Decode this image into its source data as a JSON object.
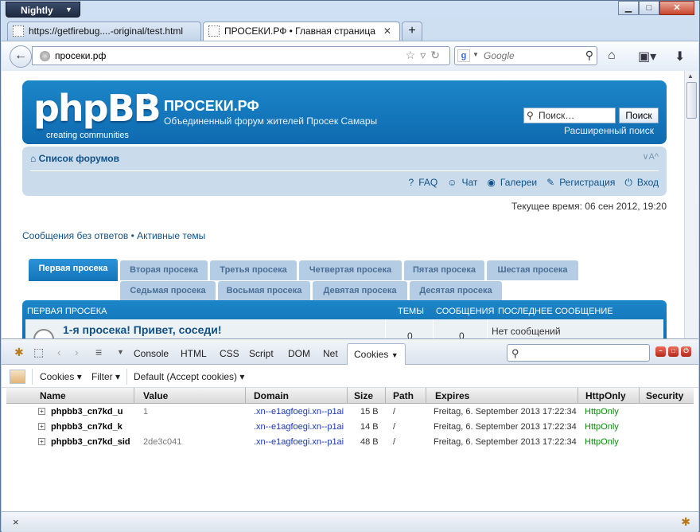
{
  "browser": {
    "app_menu": "Nightly",
    "window_buttons": {
      "minimize": "▁",
      "maximize": "□",
      "close": "✕"
    },
    "tabs": [
      {
        "label": "https://getfirebug....-original/test.html"
      },
      {
        "label": "ПРОСЕКИ.РФ • Главная страница"
      }
    ],
    "new_tab": "+",
    "url": "просеки.рф",
    "search_placeholder": "Google",
    "search_engine_icon": "g"
  },
  "site": {
    "logo": "phpBB",
    "logo_reg": "®",
    "logo_tagline": "creating  communities",
    "title": "ПРОСЕКИ.РФ",
    "description": "Объединенный форум жителей Просек Самары",
    "search_value": "Поиск…",
    "search_button": "Поиск",
    "advanced_search": "Расширенный поиск",
    "forum_list": "Список форумов",
    "font_size": "∨A^",
    "nav_links": [
      "FAQ",
      "Чат",
      "Галереи",
      "Регистрация",
      "Вход"
    ],
    "nav_icons": [
      "?",
      "☺",
      "◉",
      "✎",
      "⏻"
    ],
    "current_time": "Текущее время: 06 сен 2012, 19:20",
    "quick_links": "Сообщения без ответов • Активные темы",
    "forum_tabs_row1": [
      "Первая просека",
      "Вторая просека",
      "Третья просека",
      "Четвертая просека",
      "Пятая просека",
      "Шестая просека"
    ],
    "forum_tabs_row2": [
      "Седьмая просека",
      "Восьмая просека",
      "Девятая просека",
      "Десятая просека"
    ],
    "table_headers": {
      "forum": "ПЕРВАЯ ПРОСЕКА",
      "topics": "ТЕМЫ",
      "posts": "СООБЩЕНИЯ",
      "last": "ПОСЛЕДНЕЕ СООБЩЕНИЕ"
    },
    "forum_row": {
      "title": "1-я просека! Привет, соседи!",
      "topics": "0",
      "posts": "0",
      "last": "Нет сообщений"
    }
  },
  "firebug": {
    "tabs": [
      "Console",
      "HTML",
      "CSS",
      "Script",
      "DOM",
      "Net",
      "Cookies"
    ],
    "active_tab": "Cookies",
    "sub_toolbar": {
      "cookies": "Cookies",
      "filter": "Filter",
      "default": "Default (Accept cookies)"
    },
    "columns": [
      "Name",
      "Value",
      "Domain",
      "Size",
      "Path",
      "Expires",
      "HttpOnly",
      "Security"
    ],
    "rows": [
      {
        "name": "phpbb3_cn7kd_u",
        "value": "1",
        "domain": ".xn--e1agfoegi.xn--p1ai",
        "size": "15 B",
        "path": "/",
        "expires": "Freitag, 6. September 2013 17:22:34",
        "httponly": "HttpOnly"
      },
      {
        "name": "phpbb3_cn7kd_k",
        "value": "",
        "domain": ".xn--e1agfoegi.xn--p1ai",
        "size": "14 B",
        "path": "/",
        "expires": "Freitag, 6. September 2013 17:22:34",
        "httponly": "HttpOnly"
      },
      {
        "name": "phpbb3_cn7kd_sid",
        "value": "2de3c041",
        "domain": ".xn--e1agfoegi.xn--p1ai",
        "size": "48 B",
        "path": "/",
        "expires": "Freitag, 6. September 2013 17:22:34",
        "httponly": "HttpOnly"
      }
    ],
    "close": "×"
  },
  "colors": {
    "phpbb_blue": "#1b86c8",
    "link": "#105289",
    "httponly_green": "#0d8a0d"
  }
}
